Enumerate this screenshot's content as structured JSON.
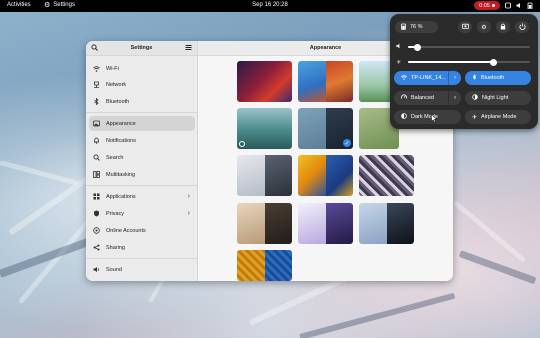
{
  "topbar": {
    "activities": "Activities",
    "app_name": "Settings",
    "clock": "Sep 16  20:28",
    "recording_time": "0:05"
  },
  "sidebar": {
    "title": "Settings",
    "items": [
      {
        "label": "Wi-Fi",
        "icon": "wifi-icon"
      },
      {
        "label": "Network",
        "icon": "network-icon"
      },
      {
        "label": "Bluetooth",
        "icon": "bluetooth-icon"
      },
      {
        "label": "Appearance",
        "icon": "appearance-icon",
        "active": true
      },
      {
        "label": "Notifications",
        "icon": "bell-icon"
      },
      {
        "label": "Search",
        "icon": "search-icon"
      },
      {
        "label": "Multitasking",
        "icon": "multitasking-icon"
      },
      {
        "label": "Applications",
        "icon": "applications-icon",
        "chevron": true
      },
      {
        "label": "Privacy",
        "icon": "privacy-icon",
        "chevron": true
      },
      {
        "label": "Online Accounts",
        "icon": "online-accounts-icon"
      },
      {
        "label": "Sharing",
        "icon": "share-icon"
      },
      {
        "label": "Sound",
        "icon": "sound-icon"
      }
    ]
  },
  "content": {
    "title": "Appearance"
  },
  "quick_settings": {
    "battery": "76 %",
    "volume_level": 0.08,
    "brightness_level": 0.7,
    "toggles": [
      {
        "label": "TP-LINK_14...",
        "icon": "wifi-icon",
        "on": true,
        "arrow": true
      },
      {
        "label": "Bluetooth",
        "icon": "bluetooth-icon",
        "on": true,
        "arrow": false
      },
      {
        "label": "Balanced",
        "icon": "power-mode-icon",
        "on": false,
        "arrow": true
      },
      {
        "label": "Night Light",
        "icon": "night-light-icon",
        "on": false,
        "arrow": false
      },
      {
        "label": "Dark Mode",
        "icon": "dark-mode-icon",
        "on": false,
        "arrow": false
      },
      {
        "label": "Airplane Mode",
        "icon": "airplane-icon",
        "on": false,
        "arrow": false
      }
    ]
  },
  "colors": {
    "accent": "#3584e4",
    "record": "#c01c28"
  }
}
